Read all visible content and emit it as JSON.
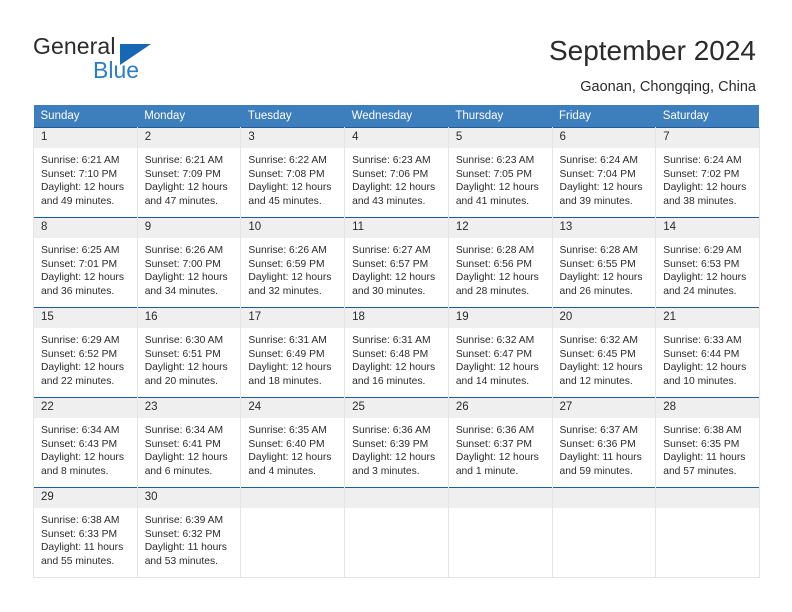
{
  "logo": {
    "primary_text": "General",
    "secondary_text": "Blue",
    "flag_icon": "triangle-flag-icon",
    "primary_color": "#2b2b2b",
    "accent_color": "#2a7dc9"
  },
  "header": {
    "title": "September 2024",
    "location": "Gaonan, Chongqing, China"
  },
  "theme": {
    "header_row_bg": "#3d7ebd",
    "header_row_text": "#ffffff",
    "daynum_bg": "#efefef",
    "week_divider": "#1f5b9e",
    "cell_border": "#e4e4e4"
  },
  "calendar": {
    "weekday_headers": [
      "Sunday",
      "Monday",
      "Tuesday",
      "Wednesday",
      "Thursday",
      "Friday",
      "Saturday"
    ],
    "weeks": [
      [
        {
          "day": "1",
          "sunrise": "Sunrise: 6:21 AM",
          "sunset": "Sunset: 7:10 PM",
          "daylight_1": "Daylight: 12 hours",
          "daylight_2": "and 49 minutes."
        },
        {
          "day": "2",
          "sunrise": "Sunrise: 6:21 AM",
          "sunset": "Sunset: 7:09 PM",
          "daylight_1": "Daylight: 12 hours",
          "daylight_2": "and 47 minutes."
        },
        {
          "day": "3",
          "sunrise": "Sunrise: 6:22 AM",
          "sunset": "Sunset: 7:08 PM",
          "daylight_1": "Daylight: 12 hours",
          "daylight_2": "and 45 minutes."
        },
        {
          "day": "4",
          "sunrise": "Sunrise: 6:23 AM",
          "sunset": "Sunset: 7:06 PM",
          "daylight_1": "Daylight: 12 hours",
          "daylight_2": "and 43 minutes."
        },
        {
          "day": "5",
          "sunrise": "Sunrise: 6:23 AM",
          "sunset": "Sunset: 7:05 PM",
          "daylight_1": "Daylight: 12 hours",
          "daylight_2": "and 41 minutes."
        },
        {
          "day": "6",
          "sunrise": "Sunrise: 6:24 AM",
          "sunset": "Sunset: 7:04 PM",
          "daylight_1": "Daylight: 12 hours",
          "daylight_2": "and 39 minutes."
        },
        {
          "day": "7",
          "sunrise": "Sunrise: 6:24 AM",
          "sunset": "Sunset: 7:02 PM",
          "daylight_1": "Daylight: 12 hours",
          "daylight_2": "and 38 minutes."
        }
      ],
      [
        {
          "day": "8",
          "sunrise": "Sunrise: 6:25 AM",
          "sunset": "Sunset: 7:01 PM",
          "daylight_1": "Daylight: 12 hours",
          "daylight_2": "and 36 minutes."
        },
        {
          "day": "9",
          "sunrise": "Sunrise: 6:26 AM",
          "sunset": "Sunset: 7:00 PM",
          "daylight_1": "Daylight: 12 hours",
          "daylight_2": "and 34 minutes."
        },
        {
          "day": "10",
          "sunrise": "Sunrise: 6:26 AM",
          "sunset": "Sunset: 6:59 PM",
          "daylight_1": "Daylight: 12 hours",
          "daylight_2": "and 32 minutes."
        },
        {
          "day": "11",
          "sunrise": "Sunrise: 6:27 AM",
          "sunset": "Sunset: 6:57 PM",
          "daylight_1": "Daylight: 12 hours",
          "daylight_2": "and 30 minutes."
        },
        {
          "day": "12",
          "sunrise": "Sunrise: 6:28 AM",
          "sunset": "Sunset: 6:56 PM",
          "daylight_1": "Daylight: 12 hours",
          "daylight_2": "and 28 minutes."
        },
        {
          "day": "13",
          "sunrise": "Sunrise: 6:28 AM",
          "sunset": "Sunset: 6:55 PM",
          "daylight_1": "Daylight: 12 hours",
          "daylight_2": "and 26 minutes."
        },
        {
          "day": "14",
          "sunrise": "Sunrise: 6:29 AM",
          "sunset": "Sunset: 6:53 PM",
          "daylight_1": "Daylight: 12 hours",
          "daylight_2": "and 24 minutes."
        }
      ],
      [
        {
          "day": "15",
          "sunrise": "Sunrise: 6:29 AM",
          "sunset": "Sunset: 6:52 PM",
          "daylight_1": "Daylight: 12 hours",
          "daylight_2": "and 22 minutes."
        },
        {
          "day": "16",
          "sunrise": "Sunrise: 6:30 AM",
          "sunset": "Sunset: 6:51 PM",
          "daylight_1": "Daylight: 12 hours",
          "daylight_2": "and 20 minutes."
        },
        {
          "day": "17",
          "sunrise": "Sunrise: 6:31 AM",
          "sunset": "Sunset: 6:49 PM",
          "daylight_1": "Daylight: 12 hours",
          "daylight_2": "and 18 minutes."
        },
        {
          "day": "18",
          "sunrise": "Sunrise: 6:31 AM",
          "sunset": "Sunset: 6:48 PM",
          "daylight_1": "Daylight: 12 hours",
          "daylight_2": "and 16 minutes."
        },
        {
          "day": "19",
          "sunrise": "Sunrise: 6:32 AM",
          "sunset": "Sunset: 6:47 PM",
          "daylight_1": "Daylight: 12 hours",
          "daylight_2": "and 14 minutes."
        },
        {
          "day": "20",
          "sunrise": "Sunrise: 6:32 AM",
          "sunset": "Sunset: 6:45 PM",
          "daylight_1": "Daylight: 12 hours",
          "daylight_2": "and 12 minutes."
        },
        {
          "day": "21",
          "sunrise": "Sunrise: 6:33 AM",
          "sunset": "Sunset: 6:44 PM",
          "daylight_1": "Daylight: 12 hours",
          "daylight_2": "and 10 minutes."
        }
      ],
      [
        {
          "day": "22",
          "sunrise": "Sunrise: 6:34 AM",
          "sunset": "Sunset: 6:43 PM",
          "daylight_1": "Daylight: 12 hours",
          "daylight_2": "and 8 minutes."
        },
        {
          "day": "23",
          "sunrise": "Sunrise: 6:34 AM",
          "sunset": "Sunset: 6:41 PM",
          "daylight_1": "Daylight: 12 hours",
          "daylight_2": "and 6 minutes."
        },
        {
          "day": "24",
          "sunrise": "Sunrise: 6:35 AM",
          "sunset": "Sunset: 6:40 PM",
          "daylight_1": "Daylight: 12 hours",
          "daylight_2": "and 4 minutes."
        },
        {
          "day": "25",
          "sunrise": "Sunrise: 6:36 AM",
          "sunset": "Sunset: 6:39 PM",
          "daylight_1": "Daylight: 12 hours",
          "daylight_2": "and 3 minutes."
        },
        {
          "day": "26",
          "sunrise": "Sunrise: 6:36 AM",
          "sunset": "Sunset: 6:37 PM",
          "daylight_1": "Daylight: 12 hours",
          "daylight_2": "and 1 minute."
        },
        {
          "day": "27",
          "sunrise": "Sunrise: 6:37 AM",
          "sunset": "Sunset: 6:36 PM",
          "daylight_1": "Daylight: 11 hours",
          "daylight_2": "and 59 minutes."
        },
        {
          "day": "28",
          "sunrise": "Sunrise: 6:38 AM",
          "sunset": "Sunset: 6:35 PM",
          "daylight_1": "Daylight: 11 hours",
          "daylight_2": "and 57 minutes."
        }
      ],
      [
        {
          "day": "29",
          "sunrise": "Sunrise: 6:38 AM",
          "sunset": "Sunset: 6:33 PM",
          "daylight_1": "Daylight: 11 hours",
          "daylight_2": "and 55 minutes."
        },
        {
          "day": "30",
          "sunrise": "Sunrise: 6:39 AM",
          "sunset": "Sunset: 6:32 PM",
          "daylight_1": "Daylight: 11 hours",
          "daylight_2": "and 53 minutes."
        },
        {
          "day": "",
          "sunrise": "",
          "sunset": "",
          "daylight_1": "",
          "daylight_2": ""
        },
        {
          "day": "",
          "sunrise": "",
          "sunset": "",
          "daylight_1": "",
          "daylight_2": ""
        },
        {
          "day": "",
          "sunrise": "",
          "sunset": "",
          "daylight_1": "",
          "daylight_2": ""
        },
        {
          "day": "",
          "sunrise": "",
          "sunset": "",
          "daylight_1": "",
          "daylight_2": ""
        },
        {
          "day": "",
          "sunrise": "",
          "sunset": "",
          "daylight_1": "",
          "daylight_2": ""
        }
      ]
    ]
  }
}
